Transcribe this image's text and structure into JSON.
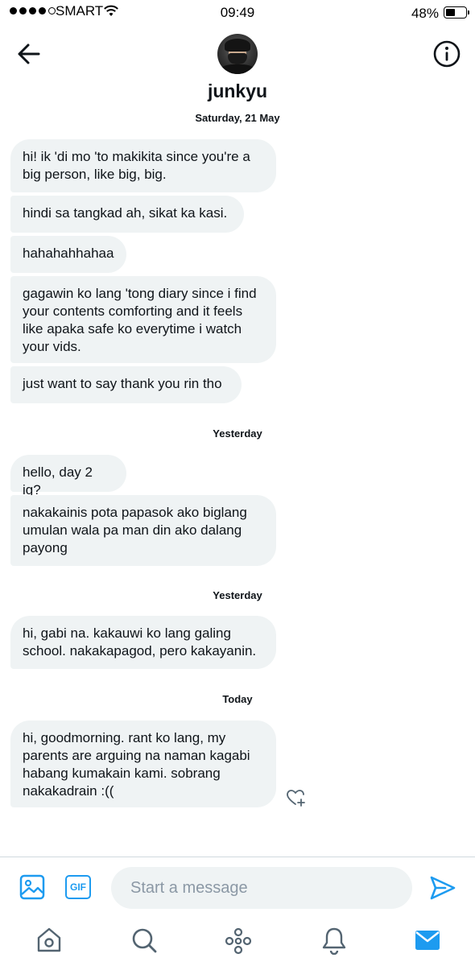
{
  "status_bar": {
    "carrier": "SMART",
    "time": "09:49",
    "battery": "48%",
    "battery_level": 0.48,
    "signal_bars_filled": 4,
    "signal_bars_total": 5
  },
  "header": {
    "back_icon": "arrow-left-icon",
    "info_icon": "info-circle-icon",
    "username": "junkyu"
  },
  "conversation": [
    {
      "date": "Saturday, 21 May",
      "messages": [
        "hi! ik 'di mo 'to makikita since you're a\nbig person, like big, big.",
        "hindi sa tangkad ah, sikat ka kasi.",
        "hahahahhahaa",
        "gagawin ko lang 'tong diary since i find\nyour contents comforting and it feels\nlike apaka safe ko everytime i watch\nyour vids.",
        "just want to say thank you rin tho"
      ]
    },
    {
      "date": "Yesterday",
      "messages": [
        "hello, day 2 ig?",
        "nakakainis pota papasok ako biglang\numulan wala pa man din ako dalang\npayong"
      ]
    },
    {
      "date": "Yesterday",
      "messages": [
        "hi, gabi na. kakauwi ko lang galing\nschool. nakakapagod, pero kakayanin."
      ]
    },
    {
      "date": "Today",
      "messages": [
        "hi, goodmorning. rant ko lang, my\nparents are arguing na naman kagabi\nhabang kumakain kami. sobrang\nnakakadrain :(("
      ]
    }
  ],
  "composer": {
    "placeholder": "Start a message",
    "gif_label": "GIF"
  },
  "tabs": [
    "home-icon",
    "search-icon",
    "spaces-icon",
    "notifications-icon",
    "messages-icon"
  ],
  "colors": {
    "accent": "#1d9bf0",
    "bubble_bg": "#eff3f4",
    "text": "#0f1419",
    "icon_gray": "#536471"
  }
}
